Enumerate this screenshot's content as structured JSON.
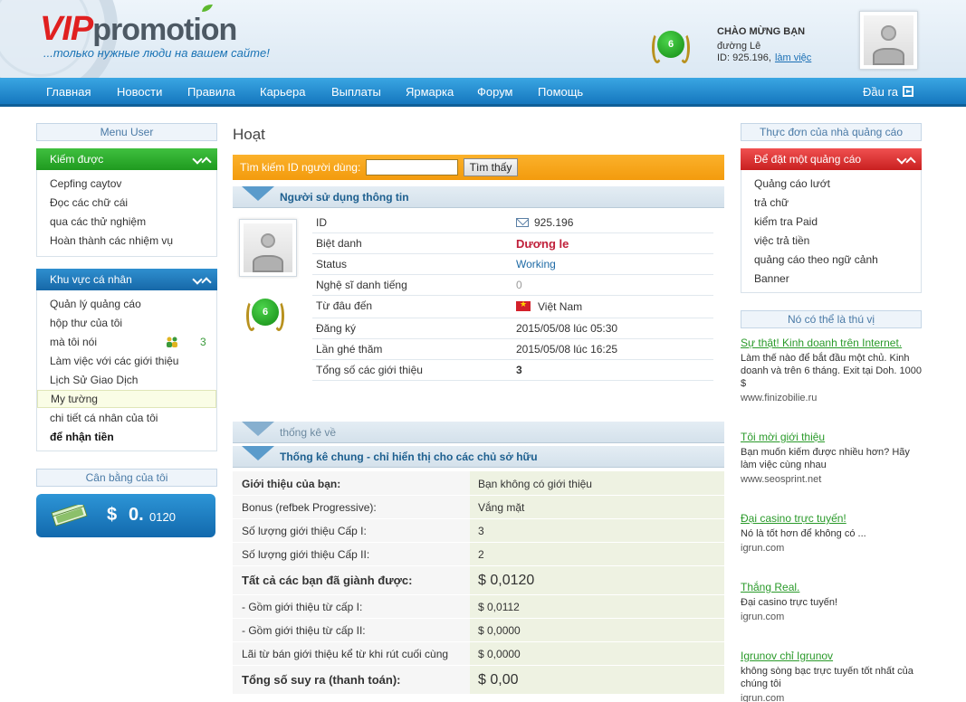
{
  "header": {
    "logo_vip": "VIP",
    "logo_promo": "promotion",
    "slogan": "...только нужные люди на вашем сайте!",
    "level": "6",
    "greeting": "CHÀO MỪNG BẠN",
    "username": "đường Lê",
    "user_id": "ID: 925.196,",
    "status_link": "làm việc"
  },
  "nav": {
    "items": [
      "Главная",
      "Новости",
      "Правила",
      "Карьера",
      "Выплаты",
      "Ярмарка",
      "Форум",
      "Помощь"
    ],
    "logout": "Đầu ra"
  },
  "left": {
    "menu_title": "Menu User",
    "earn_title": "Kiếm được",
    "earn_items": [
      "Cepfing caytov",
      "Đọc các chữ cái",
      "qua các thử nghiệm",
      "Hoàn thành các nhiệm vụ"
    ],
    "personal_title": "Khu vực cá nhân",
    "personal_items": [
      "Quản lý quảng cáo",
      "hộp thư của tôi",
      "mà tôi nói",
      "Làm việc với các giới thiệu",
      "Lịch Sử Giao Dịch",
      "My tường",
      "chi tiết cá nhân của tôi",
      "để nhận tiền"
    ],
    "messages_count": "3",
    "balance_title": "Cân bằng của tôi",
    "balance_currency": "$",
    "balance_value": "0.",
    "balance_decimals": "0120"
  },
  "main": {
    "page_title": "Hoạt",
    "search_label": "Tìm kiếm ID người dùng:",
    "search_value": "",
    "search_button": "Tìm thấy",
    "user_section_title": "Người sử dụng thông tin",
    "level": "6",
    "info_rows": [
      {
        "k": "ID",
        "v": "925.196"
      },
      {
        "k": "Biệt danh",
        "v": "Dương le"
      },
      {
        "k": "Status",
        "v": "Working"
      },
      {
        "k": "Nghệ sĩ danh tiếng",
        "v": "0"
      },
      {
        "k": "Từ đâu đến",
        "v": "Việt Nam"
      },
      {
        "k": "Đăng ký",
        "v": "2015/05/08 lúc 05:30"
      },
      {
        "k": "Lần ghé thăm",
        "v": "2015/05/08 lúc 16:25"
      },
      {
        "k": "Tổng số các giới thiệu",
        "v": "3"
      }
    ],
    "stats_title": "thống kê về",
    "general_title": "Thống kê chung - chỉ hiển thị cho các chủ sở hữu",
    "stats_rows": [
      {
        "k": "Giới thiệu của bạn:",
        "v": "Bạn không có giới thiệu"
      },
      {
        "k": "Bonus (refbek Progressive):",
        "v": "Vắng mặt"
      },
      {
        "k": "Số lượng giới thiệu Cấp I:",
        "v": "3"
      },
      {
        "k": "Số lượng giới thiệu Cấp II:",
        "v": "2"
      },
      {
        "k": "Tất cả các bạn đã giành được:",
        "v": "$ 0,0120"
      },
      {
        "k": "- Gồm giới thiệu từ cấp I:",
        "v": "$ 0,0112"
      },
      {
        "k": "- Gồm giới thiệu từ cấp II:",
        "v": "$ 0,0000"
      },
      {
        "k": "Lãi từ bán giới thiệu kể từ khi rút cuối cùng",
        "v": "$ 0,0000"
      },
      {
        "k": "Tổng số suy ra (thanh toán):",
        "v": "$ 0,00"
      }
    ]
  },
  "right": {
    "ad_menu_title": "Thực đơn của nhà quảng cáo",
    "place_ad_title": "Để đặt một quảng cáo",
    "ad_items": [
      "Quảng cáo lướt",
      "trả chữ",
      "kiểm tra Paid",
      "việc trả tiền",
      "quảng cáo theo ngữ cảnh",
      "Banner"
    ],
    "interesting_title": "Nó có thể là thú vị",
    "promos": [
      {
        "t": "Sự thật! Kinh doanh trên Internet.",
        "d": "Làm thế nào để bắt đầu một chủ. Kinh doanh và trên 6 tháng. Exit tại Doh. 1000 $",
        "u": "www.finizobilie.ru"
      },
      {
        "t": "Tôi mời giới thiệu",
        "d": "Bạn muốn kiếm được nhiều hơn? Hãy làm việc cùng nhau",
        "u": "www.seosprint.net"
      },
      {
        "t": "Đại casino trực tuyến!",
        "d": "Nó là tốt hơn để không có ...",
        "u": "igrun.com"
      },
      {
        "t": "Thắng Real.",
        "d": "Đại casino trực tuyến!",
        "u": "igrun.com"
      },
      {
        "t": "Igrunov chỉ Igrunov",
        "d": "không sòng bạc trực tuyến tốt nhất của chúng tôi",
        "u": "igrun.com"
      }
    ]
  }
}
